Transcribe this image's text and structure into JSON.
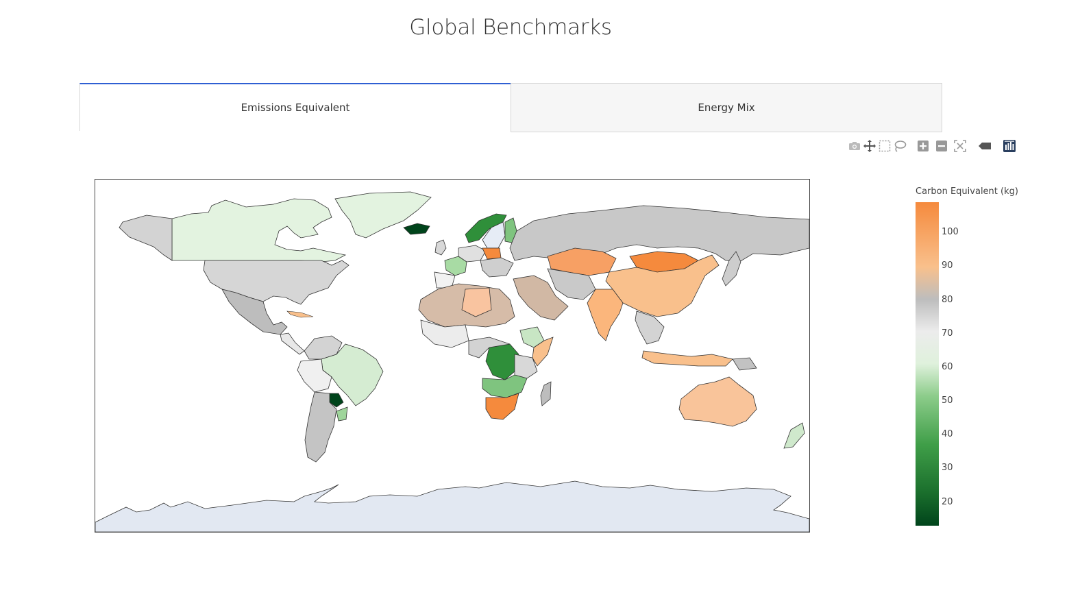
{
  "page": {
    "title": "Global Benchmarks"
  },
  "tabs": [
    {
      "label": "Emissions Equivalent",
      "active": true
    },
    {
      "label": "Energy Mix",
      "active": false
    }
  ],
  "modebar": {
    "icons": [
      "camera-icon",
      "pan-icon",
      "box-select-icon",
      "lasso-icon",
      "zoom-in-icon",
      "zoom-out-icon",
      "reset-icon",
      "hover-icon",
      "plotly-logo-icon"
    ]
  },
  "colorbar": {
    "title": "Carbon Equivalent (kg)",
    "min": 13,
    "max": 109,
    "ticks": [
      "100",
      "90",
      "80",
      "70",
      "60",
      "50",
      "40",
      "30",
      "20"
    ],
    "tick_values": [
      100,
      90,
      80,
      70,
      60,
      50,
      40,
      30,
      20
    ],
    "colors": [
      "#f58a3d",
      "#f9c08c",
      "#bfbfbf",
      "#f2f2f2",
      "#cfe9cc",
      "#6ab86d",
      "#2f8f3a",
      "#00441b"
    ]
  },
  "map": {
    "land_default": "#d3d3d3",
    "antarctica": "#e2e8f2",
    "regions": [
      {
        "name": "Canada",
        "value": 62
      },
      {
        "name": "Greenland",
        "value": 62
      },
      {
        "name": "USA",
        "value": 80
      },
      {
        "name": "Mexico",
        "value": 85
      },
      {
        "name": "Brazil",
        "value": 60
      },
      {
        "name": "Paraguay",
        "value": 13
      },
      {
        "name": "Argentina",
        "value": 82
      },
      {
        "name": "Russia",
        "value": 84
      },
      {
        "name": "China",
        "value": 96
      },
      {
        "name": "Mongolia",
        "value": 105
      },
      {
        "name": "Kazakhstan",
        "value": 104
      },
      {
        "name": "India",
        "value": 100
      },
      {
        "name": "Australia",
        "value": 96
      },
      {
        "name": "South Africa",
        "value": 106
      },
      {
        "name": "DR Congo",
        "value": 38
      },
      {
        "name": "Norway",
        "value": 32
      },
      {
        "name": "Sweden",
        "value": 72
      },
      {
        "name": "Iceland",
        "value": 18
      },
      {
        "name": "France",
        "value": 55
      },
      {
        "name": "Poland",
        "value": 106
      },
      {
        "name": "Indonesia",
        "value": 98
      },
      {
        "name": "Ethiopia",
        "value": 58
      },
      {
        "name": "Algeria",
        "value": 88
      },
      {
        "name": "New Zealand",
        "value": 58
      }
    ]
  }
}
